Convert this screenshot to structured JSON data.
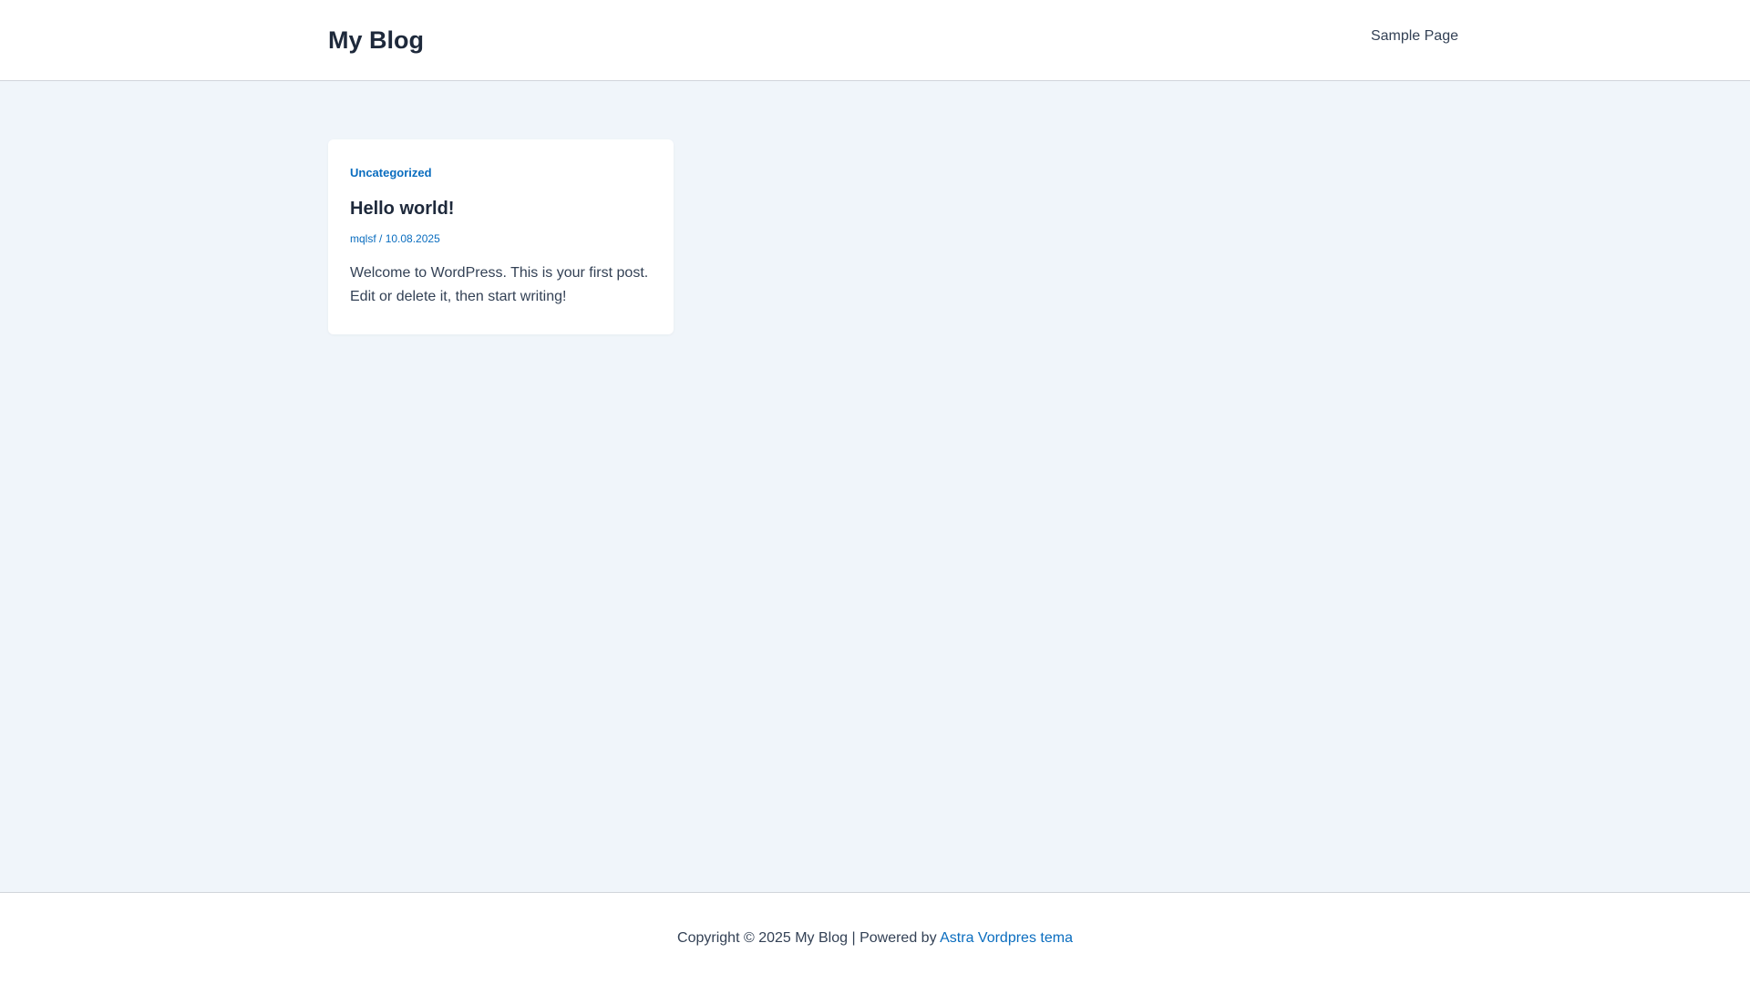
{
  "header": {
    "site_title": "My Blog",
    "nav": [
      {
        "label": "Sample Page"
      }
    ]
  },
  "posts": [
    {
      "category": "Uncategorized",
      "title": "Hello world!",
      "author": "mqlsf",
      "meta_separator": " / ",
      "date": "10.08.2025",
      "excerpt_line1": "Welcome to WordPress. This is your first post.",
      "excerpt_line2": "Edit or delete it, then start writing!"
    }
  ],
  "footer": {
    "copyright_text": "Copyright © 2025 My Blog | Powered by ",
    "theme_link": "Astra Vordpres tema"
  },
  "colors": {
    "accent": "#0a6dbf",
    "background": "#f0f5fa",
    "heading": "#1e293b",
    "text": "#334155"
  }
}
